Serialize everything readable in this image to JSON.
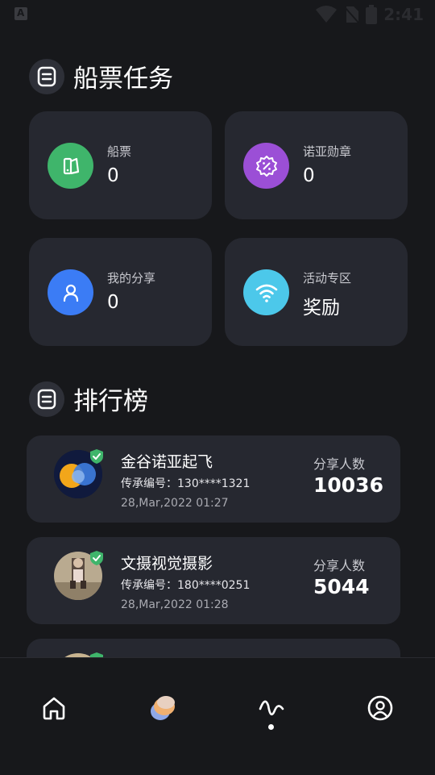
{
  "status_bar": {
    "time": "2:41"
  },
  "sections": {
    "tasks_title": "船票任务",
    "rank_title": "排行榜"
  },
  "cards": [
    {
      "label": "船票",
      "value": "0",
      "icon": "ticket-icon",
      "color": "#3fb56b"
    },
    {
      "label": "诺亚勋章",
      "value": "0",
      "icon": "badge-percent-icon",
      "color": "#9b4fd6"
    },
    {
      "label": "我的分享",
      "value": "0",
      "icon": "user-icon",
      "color": "#3b7cf5"
    },
    {
      "label": "活动专区",
      "value": "奖励",
      "icon": "wifi-icon",
      "color": "#4cc8ea"
    }
  ],
  "rankings": [
    {
      "name": "金谷诺亚起飞",
      "code": "传承编号：130****1321",
      "date": "28,Mar,2022 01:27",
      "share_label": "分享人数",
      "share_count": "10036"
    },
    {
      "name": "文摄视觉摄影",
      "code": "传承编号：180****0251",
      "date": "28,Mar,2022 01:28",
      "share_label": "分享人数",
      "share_count": "5044"
    },
    {
      "name": "",
      "code": "",
      "date": "",
      "share_label": "",
      "share_count": ""
    }
  ],
  "nav": [
    {
      "name": "home",
      "icon": "home-icon"
    },
    {
      "name": "planet",
      "icon": "planet-icon"
    },
    {
      "name": "activity",
      "icon": "activity-icon",
      "active": true
    },
    {
      "name": "profile",
      "icon": "profile-icon"
    }
  ]
}
